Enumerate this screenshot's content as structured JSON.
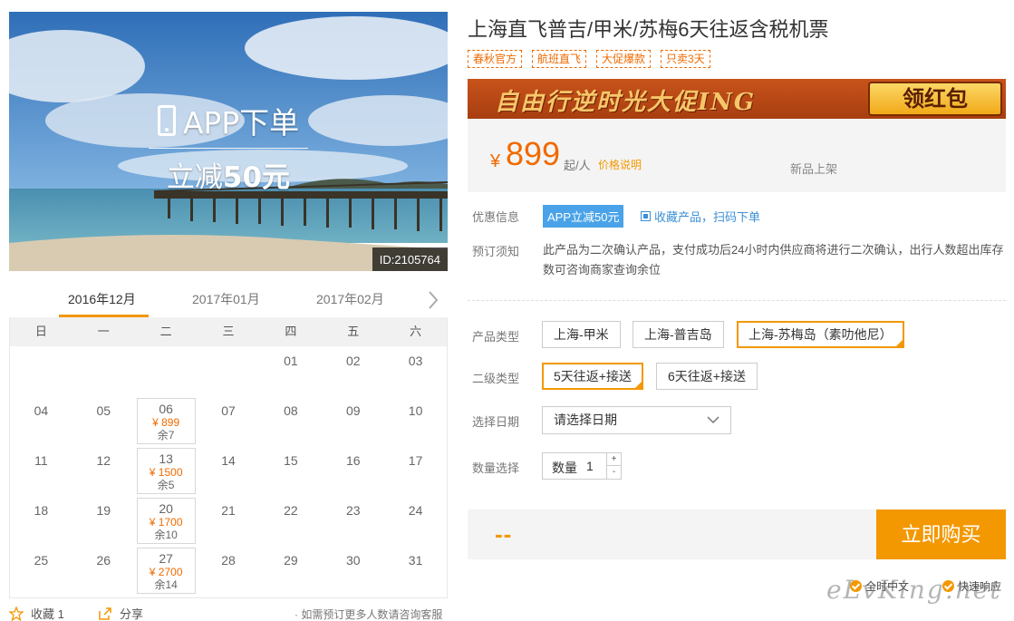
{
  "hero": {
    "caption_line1": "APP下单",
    "caption_line2_prefix": "立减",
    "caption_line2_amount": "50元",
    "id_label": "ID:2105764"
  },
  "calendar": {
    "months": [
      "2016年12月",
      "2017年01月",
      "2017年02月"
    ],
    "active_month_index": 0,
    "weekdays": [
      "日",
      "一",
      "二",
      "三",
      "四",
      "五",
      "六"
    ],
    "weeks": [
      [
        {
          "day": ""
        },
        {
          "day": ""
        },
        {
          "day": ""
        },
        {
          "day": ""
        },
        {
          "day": "01"
        },
        {
          "day": "02"
        },
        {
          "day": "03"
        }
      ],
      [
        {
          "day": "04"
        },
        {
          "day": "05"
        },
        {
          "day": "06",
          "price": "¥ 899",
          "left": "余7"
        },
        {
          "day": "07"
        },
        {
          "day": "08"
        },
        {
          "day": "09"
        },
        {
          "day": "10"
        }
      ],
      [
        {
          "day": "11"
        },
        {
          "day": "12"
        },
        {
          "day": "13",
          "price": "¥ 1500",
          "left": "余5"
        },
        {
          "day": "14"
        },
        {
          "day": "15"
        },
        {
          "day": "16"
        },
        {
          "day": "17"
        }
      ],
      [
        {
          "day": "18"
        },
        {
          "day": "19"
        },
        {
          "day": "20",
          "price": "¥ 1700",
          "left": "余10"
        },
        {
          "day": "21"
        },
        {
          "day": "22"
        },
        {
          "day": "23"
        },
        {
          "day": "24"
        }
      ],
      [
        {
          "day": "25"
        },
        {
          "day": "26"
        },
        {
          "day": "27",
          "price": "¥ 2700",
          "left": "余14"
        },
        {
          "day": "28"
        },
        {
          "day": "29"
        },
        {
          "day": "30"
        },
        {
          "day": "31"
        }
      ]
    ]
  },
  "bottom": {
    "favorite": "收藏 1",
    "share": "分享",
    "note": "如需预订更多人数请咨询客服"
  },
  "product": {
    "title": "上海直飞普吉/甲米/苏梅6天往返含税机票",
    "tags": [
      "春秋官方",
      "航班直飞",
      "大促爆款",
      "只卖3天"
    ],
    "banner_text": "自由行逆时光大促ING",
    "banner_button": "领红包",
    "price_symbol": "¥",
    "price": "899",
    "price_unit": "起/人",
    "price_explain": "价格说明",
    "new_label": "新品上架",
    "promo_label": "优惠信息",
    "promo_badge": "APP立减50元",
    "fav_scan": "收藏产品，扫码下单",
    "notice_label": "预订须知",
    "notice_text": "此产品为二次确认产品，支付成功后24小时内供应商将进行二次确认，出行人数超出库存数可咨询商家查询余位",
    "type_label": "产品类型",
    "types": [
      "上海-甲米",
      "上海-普吉岛",
      "上海-苏梅岛（素叻他尼）"
    ],
    "selected_type": 2,
    "subtype_label": "二级类型",
    "subtypes": [
      "5天往返+接送",
      "6天往返+接送"
    ],
    "selected_subtype": 0,
    "date_label": "选择日期",
    "date_value": "请选择日期",
    "qty_label": "数量选择",
    "qty_prefix": "数量",
    "qty_value": "1",
    "total": "--",
    "buy_button": "立即购买",
    "assure1": "全时中文",
    "assure2": "快速响应"
  },
  "watermark": "eLvKing.net",
  "colors": {
    "accent": "#f39800",
    "price": "#f06a00",
    "link": "#3b8fd6",
    "badge": "#4aa3e8"
  }
}
